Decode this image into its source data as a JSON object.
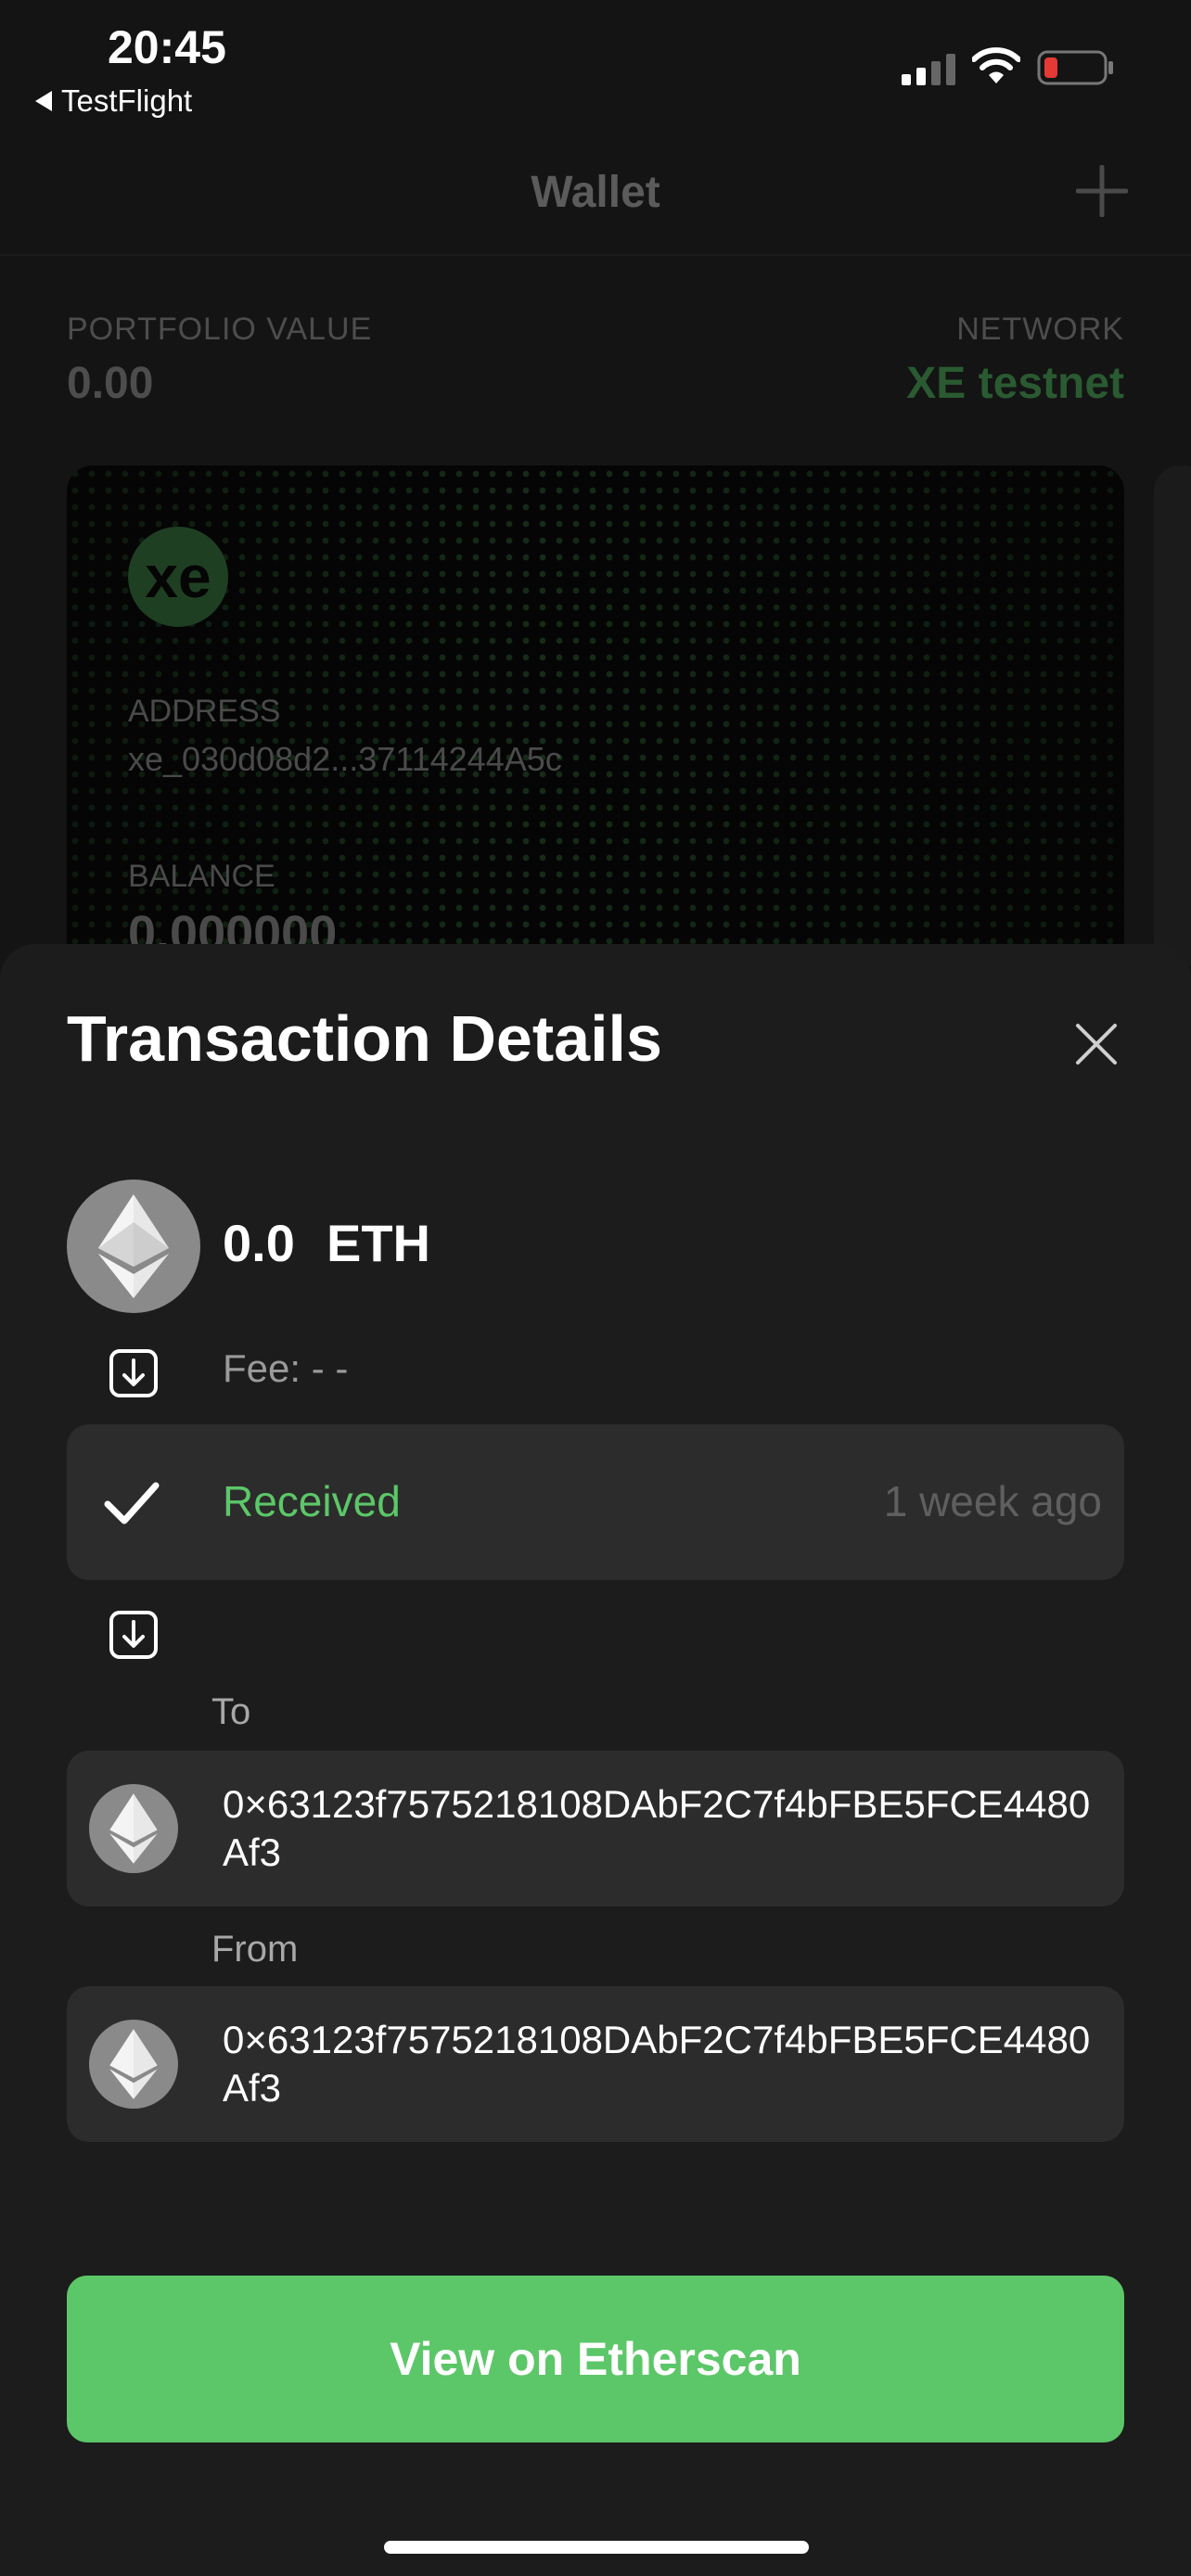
{
  "status_bar": {
    "time": "20:45",
    "back_app": "TestFlight"
  },
  "wallet": {
    "nav_title": "Wallet",
    "portfolio_label": "PORTFOLIO VALUE",
    "portfolio_value": "0.00",
    "network_label": "NETWORK",
    "network_value": "XE testnet",
    "card": {
      "logo": "xe",
      "address_label": "ADDRESS",
      "address": "xe_030d08d2...37114244A5c",
      "balance_label": "BALANCE",
      "balance": "0.000000"
    }
  },
  "modal": {
    "title": "Transaction Details",
    "amount": "0.0",
    "unit": "ETH",
    "fee": "Fee: - -",
    "status": "Received",
    "time_ago": "1 week ago",
    "to_label": "To",
    "to_address": "0×63123f7575218108DAbF2C7f4bFBE5FCE4480Af3",
    "from_label": "From",
    "from_address": "0×63123f7575218108DAbF2C7f4bFBE5FCE4480Af3",
    "cta_label": "View on Etherscan"
  },
  "colors": {
    "accent": "#5cc768",
    "sheet": "#1c1c1c",
    "row": "#2c2c2c"
  },
  "icons": [
    "back-arrow-icon",
    "signal-icon",
    "wifi-icon",
    "battery-icon",
    "plus-icon",
    "xe-logo",
    "close-icon",
    "ethereum-icon",
    "arrow-down-box-icon",
    "checkmark-icon"
  ]
}
